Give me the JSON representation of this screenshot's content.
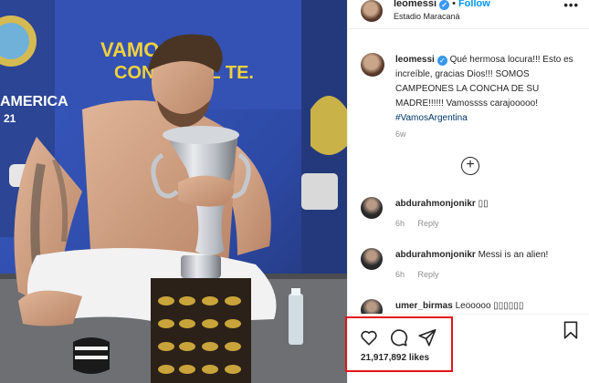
{
  "header": {
    "username": "leomessi",
    "follow_label": "Follow",
    "location": "Estadio Maracaná",
    "more_icon": "more-icon"
  },
  "photo": {
    "banner_line1": "VAMOS",
    "banner_line2": "CONMEBOL TE.",
    "banner_left": "AMERICA",
    "banner_left_num": "21"
  },
  "caption": {
    "username": "leomessi",
    "text": "Qué hermosa locura!!! Esto es increíble, gracias Dios!!! SOMOS CAMPEONES LA CONCHA DE SU MADRE!!!!!! Vamossss carajooooo!",
    "hashtag": "#VamosArgentina",
    "time": "6w"
  },
  "comments": [
    {
      "username": "abdurahmonjonikr",
      "text": "▯▯",
      "time": "6h",
      "reply": "Reply"
    },
    {
      "username": "abdurahmonjonikr",
      "text": "Messi is an alien!",
      "time": "6h",
      "reply": "Reply"
    },
    {
      "username": "umer_birmas",
      "text": "Leooooo ▯▯▯▯▯▯",
      "time": "",
      "reply": ""
    }
  ],
  "actions": {
    "likes": "21,917,892 likes"
  },
  "colors": {
    "accent": "#0095f6",
    "verified": "#3897f0",
    "highlight": "#e3141a"
  }
}
